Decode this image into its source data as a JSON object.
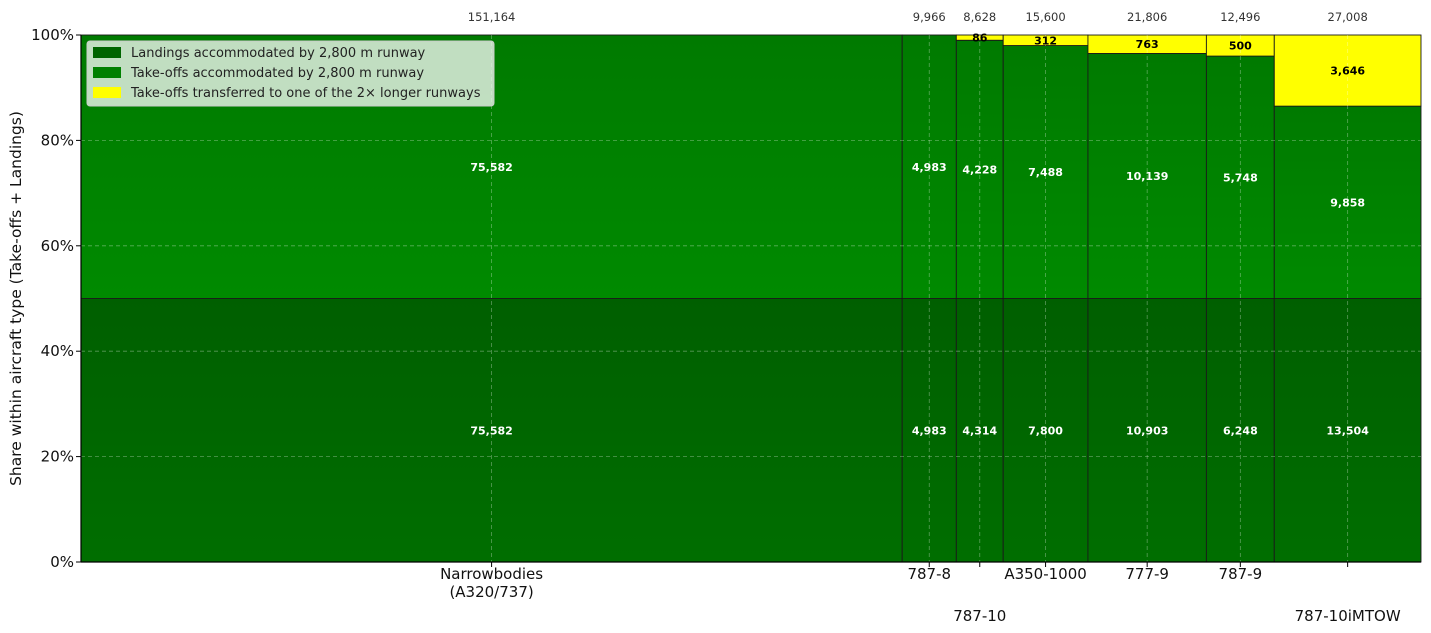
{
  "chart_data": {
    "type": "bar",
    "subtype": "marimekko-stacked-100",
    "ylabel": "Share within aircraft type (Take-offs + Landings)",
    "xlabel": "",
    "ylim": [
      0,
      100
    ],
    "y_ticks": [
      "0%",
      "20%",
      "40%",
      "60%",
      "80%",
      "100%"
    ],
    "grid": true,
    "legend_position": "top-left",
    "categories": [
      {
        "label": "Narrowbodies\n(A320/737)",
        "label_row": 0,
        "total": 151164,
        "total_label": "151,164"
      },
      {
        "label": "787-8",
        "label_row": 0,
        "total": 9966,
        "total_label": "9,966"
      },
      {
        "label": "787-10",
        "label_row": 1,
        "total": 8628,
        "total_label": "8,628"
      },
      {
        "label": "A350-1000",
        "label_row": 0,
        "total": 15600,
        "total_label": "15,600"
      },
      {
        "label": "777-9",
        "label_row": 0,
        "total": 21806,
        "total_label": "21,806"
      },
      {
        "label": "787-9",
        "label_row": 0,
        "total": 12496,
        "total_label": "12,496"
      },
      {
        "label": "787-10iMTOW",
        "label_row": 1,
        "total": 27008,
        "total_label": "27,008"
      }
    ],
    "series": [
      {
        "name": "Landings accommodated by 2,800 m runway",
        "color": "#006400",
        "label_class": "white",
        "values": [
          75582,
          4983,
          4314,
          7800,
          10903,
          6248,
          13504
        ],
        "labels": [
          "75,582",
          "4,983",
          "4,314",
          "7,800",
          "10,903",
          "6,248",
          "13,504"
        ]
      },
      {
        "name": "Take-offs accommodated by 2,800 m runway",
        "color": "#008000",
        "label_class": "white",
        "values": [
          75582,
          4983,
          4228,
          7488,
          10139,
          5748,
          9858
        ],
        "labels": [
          "75,582",
          "4,983",
          "4,228",
          "7,488",
          "10,139",
          "5,748",
          "9,858"
        ]
      },
      {
        "name": "Take-offs transferred to one of the 2× longer runways",
        "color": "#ffff00",
        "label_class": "dark",
        "values": [
          0,
          0,
          86,
          312,
          763,
          500,
          3646
        ],
        "labels": [
          "",
          "",
          "86",
          "312",
          "763",
          "500",
          "3,646"
        ]
      }
    ]
  }
}
